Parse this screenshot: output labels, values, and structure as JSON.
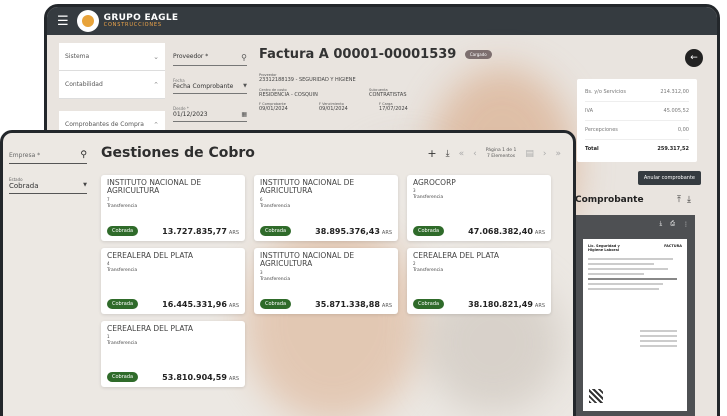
{
  "back": {
    "brand_main": "GRUPO EAGLE",
    "brand_sub": "CONSTRUCCIONES",
    "sidebar": {
      "items": [
        {
          "label": "Sistema"
        },
        {
          "label": "Contabilidad"
        },
        {
          "label": "Comprobantes de Compra"
        }
      ]
    },
    "filters": {
      "proveedor_placeholder": "Proveedor *",
      "fecha_label": "Fecha",
      "fecha_value": "Fecha Comprobante",
      "desde_label": "Desde *",
      "desde_value": "01/12/2023"
    },
    "factura": {
      "title": "Factura A 00001-00001539",
      "status": "Cargado",
      "proveedor_label": "Proveedor",
      "proveedor_value": "23312188139 - SEGURIDAD Y HIGIENE",
      "centro_label": "Centro de costo",
      "centro_value": "RESIDENCIA - COSQUIN",
      "subcuenta_label": "Subcuenta",
      "subcuenta_value": "CONTRATISTAS",
      "fcomp_label": "F Comprobante",
      "fcomp_value": "09/01/2024",
      "fvenc_label": "F Vencimiento",
      "fvenc_value": "09/01/2024",
      "fcarga_label": "F Carga",
      "fcarga_value": "17/07/2024"
    },
    "totals": [
      {
        "label": "Bs. y/o Servicios",
        "value": "214.312,00"
      },
      {
        "label": "IVA",
        "value": "45.005,52"
      },
      {
        "label": "Percepciones",
        "value": "0,00"
      },
      {
        "label": "Total",
        "value": "259.317,52"
      }
    ],
    "anular_label": "Anular comprobante",
    "comprobante_title": "Comprobante",
    "doc_head": "Lic. Seguridad y Higiene Laboral",
    "doc_type": "FACTURA"
  },
  "front": {
    "empresa_placeholder": "Empresa *",
    "estado_label": "Estado",
    "estado_value": "Cobrada",
    "title": "Gestiones de Cobro",
    "pager_line1": "Página 1 de 1",
    "pager_line2": "7 Elementos",
    "cards": [
      {
        "name": "INSTITUTO NACIONAL DE AGRICULTURA",
        "num": "7",
        "method": "Transferencia",
        "status": "Cobrada",
        "amount": "13.727.835,77",
        "currency": "ARS"
      },
      {
        "name": "INSTITUTO NACIONAL DE AGRICULTURA",
        "num": "6",
        "method": "Transferencia",
        "status": "Cobrada",
        "amount": "38.895.376,43",
        "currency": "ARS"
      },
      {
        "name": "AGROCORP",
        "num": "3",
        "method": "Transferencia",
        "status": "Cobrada",
        "amount": "47.068.382,40",
        "currency": "ARS"
      },
      {
        "name": "CEREALERA DEL PLATA",
        "num": "4",
        "method": "Transferencia",
        "status": "Cobrada",
        "amount": "16.445.331,96",
        "currency": "ARS"
      },
      {
        "name": "INSTITUTO NACIONAL DE AGRICULTURA",
        "num": "3",
        "method": "Transferencia",
        "status": "Cobrada",
        "amount": "35.871.338,88",
        "currency": "ARS"
      },
      {
        "name": "CEREALERA DEL PLATA",
        "num": "2",
        "method": "Transferencia",
        "status": "Cobrada",
        "amount": "38.180.821,49",
        "currency": "ARS"
      },
      {
        "name": "CEREALERA DEL PLATA",
        "num": "1",
        "method": "Transferencia",
        "status": "Cobrada",
        "amount": "53.810.904,59",
        "currency": "ARS"
      }
    ]
  },
  "colors": {
    "dark": "#353b40",
    "accent_orange": "#f0a64a",
    "status_green": "#2f6b2a",
    "badge_gray": "#7d6f6f"
  }
}
